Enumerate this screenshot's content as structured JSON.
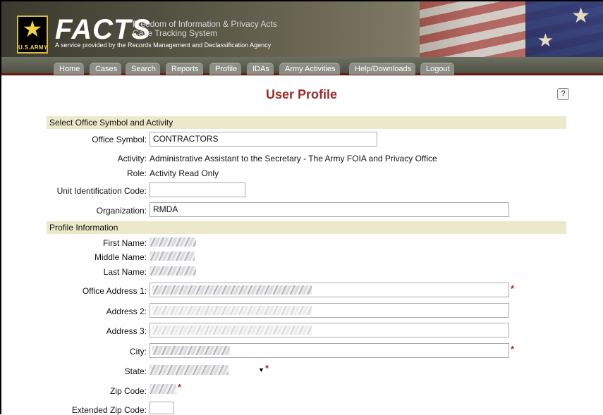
{
  "banner": {
    "title": "FACTS",
    "subtitle_line1": "Freedom of Information & Privacy Acts",
    "subtitle_line2": "Case Tracking System",
    "tagline": "A service provided by the Records Management and Declassification Agency",
    "logo_text": "U.S.ARMY"
  },
  "nav": {
    "tabs": [
      {
        "label": "Home"
      },
      {
        "label": "Cases"
      },
      {
        "label": "Search"
      },
      {
        "label": "Reports"
      },
      {
        "label": "Profile"
      },
      {
        "label": "IDAs"
      },
      {
        "label": "Army Activities"
      },
      {
        "label": "Help/Downloads"
      },
      {
        "label": "Logout"
      }
    ]
  },
  "page": {
    "title": "User Profile",
    "help_label": "?"
  },
  "section_office": {
    "title": "Select Office Symbol and Activity",
    "office_symbol_label": "Office Symbol:",
    "office_symbol_value": "CONTRACTORS",
    "activity_label": "Activity:",
    "activity_value": "Administrative Assistant to the Secretary - The Army FOIA and Privacy Office",
    "role_label": "Role:",
    "role_value": "Activity Read Only",
    "uic_label": "Unit Identification Code:",
    "uic_value": "",
    "organization_label": "Organization:",
    "organization_value": "RMDA"
  },
  "section_profile": {
    "title": "Profile Information",
    "first_name_label": "First Name:",
    "middle_name_label": "Middle Name:",
    "last_name_label": "Last Name:",
    "office_address1_label": "Office Address 1:",
    "address2_label": "Address 2:",
    "address3_label": "Address 3:",
    "city_label": "City:",
    "state_label": "State:",
    "zip_label": "Zip Code:",
    "ext_zip_label": "Extended Zip Code:",
    "required_mark": "*"
  },
  "colors": {
    "title_red": "#9a2a2a",
    "section_bg": "#ebe9c9",
    "required_red": "#c02020",
    "nav_accent": "#6b1810"
  }
}
